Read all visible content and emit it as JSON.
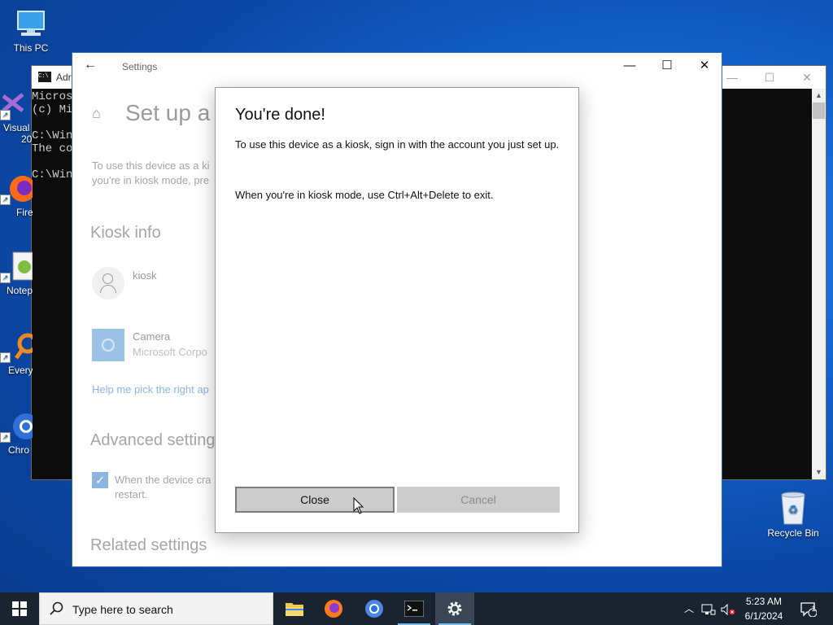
{
  "desktop": {
    "icons": [
      {
        "label": "This PC"
      },
      {
        "label": "Visual",
        "label2": "20"
      },
      {
        "label": "Fire"
      },
      {
        "label": "Notep"
      },
      {
        "label": "Every"
      },
      {
        "label": "Chro"
      }
    ],
    "recycle_bin": "Recycle Bin"
  },
  "cmd": {
    "title": "Adr",
    "lines": [
      "Micros",
      "(c) Mi",
      "",
      "C:\\Win",
      "The co",
      "",
      "C:\\Win"
    ]
  },
  "settings": {
    "app_title": "Settings",
    "page_title": "Set up a k",
    "desc_line1": "To use this device as a ki",
    "desc_line2": "you're in kiosk mode, pre",
    "kiosk_info_heading": "Kiosk info",
    "account_name": "kiosk",
    "app_name": "Camera",
    "app_publisher": "Microsoft Corpo",
    "help_link": "Help me pick the right ap",
    "advanced_heading": "Advanced setting",
    "checkbox_line1": "When the device cra",
    "checkbox_line2": "restart.",
    "related_heading": "Related settings"
  },
  "dialog": {
    "title": "You're done!",
    "message1": "To use this device as a kiosk, sign in with the account you just set up.",
    "message2": "When you're in kiosk mode, use Ctrl+Alt+Delete to exit.",
    "close_label": "Close",
    "cancel_label": "Cancel"
  },
  "taskbar": {
    "search_placeholder": "Type here to search",
    "apps": [
      "file-explorer",
      "firefox",
      "chromium",
      "terminal",
      "settings"
    ],
    "time": "5:23 AM",
    "date": "6/1/2024",
    "notification_count": "1"
  },
  "colors": {
    "accent": "#0078d7",
    "taskbar": "#1a2330",
    "desktop": "#0b49a8"
  }
}
